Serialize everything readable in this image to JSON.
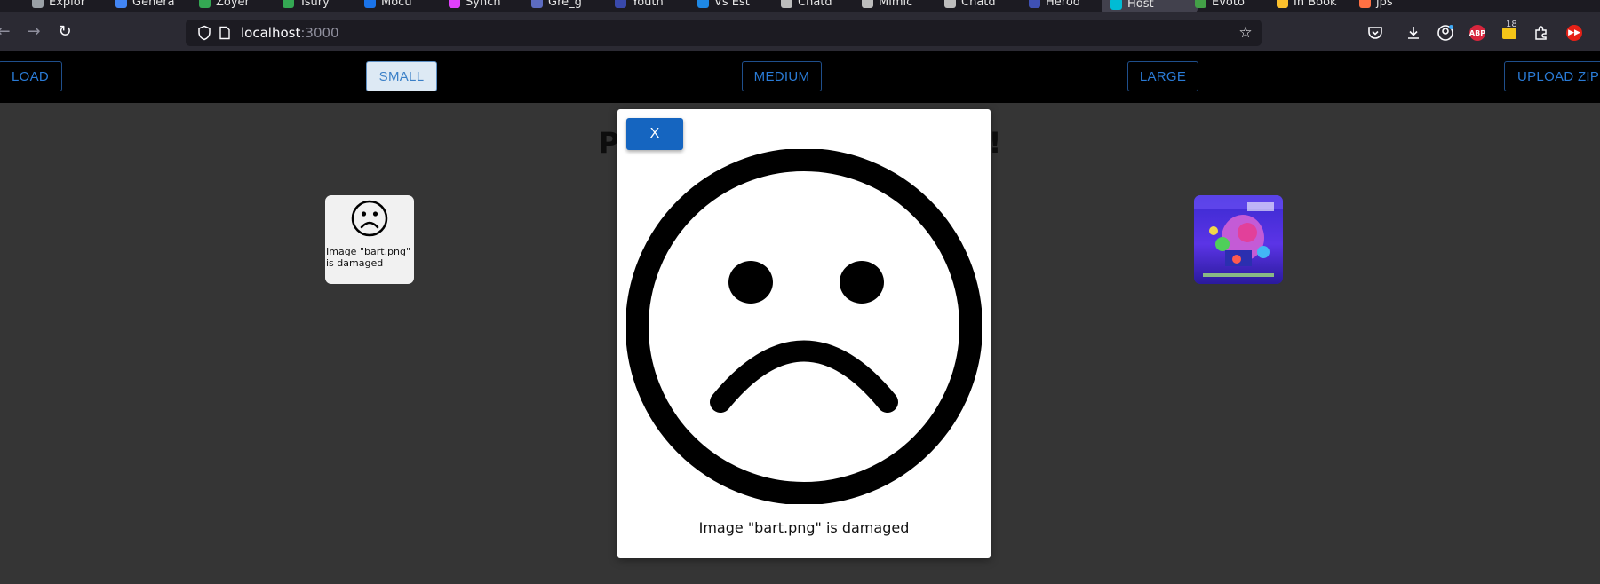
{
  "browser": {
    "tabs": [
      {
        "label": "Explor",
        "color": "#9aa0a6"
      },
      {
        "label": "Genera",
        "color": "#4285f4"
      },
      {
        "label": "Zoyer",
        "color": "#34a853"
      },
      {
        "label": "Tsury",
        "color": "#34a853"
      },
      {
        "label": "Mocu",
        "color": "#1a73e8"
      },
      {
        "label": "Synch",
        "color": "#e040fb"
      },
      {
        "label": "Gre_g",
        "color": "#5c6bc0"
      },
      {
        "label": "Youth",
        "color": "#3949ab"
      },
      {
        "label": "Vs Est",
        "color": "#1e88e5"
      },
      {
        "label": "Chatd",
        "color": "#bdbdbd"
      },
      {
        "label": "Mimic",
        "color": "#bdbdbd"
      },
      {
        "label": "Chatd",
        "color": "#bdbdbd"
      },
      {
        "label": "Herod",
        "color": "#3f51b5"
      },
      {
        "label": "Host",
        "color": "#00bcd4",
        "active": true
      },
      {
        "label": "Evoto",
        "color": "#43a047"
      },
      {
        "label": "In Book",
        "color": "#fbc02d"
      },
      {
        "label": "jps",
        "color": "#ff7043"
      }
    ],
    "url_host": "localhost",
    "url_port": ":3000",
    "extension_badge": "18",
    "abp_label": "ABP"
  },
  "toolbar": {
    "load": "LOAD",
    "small": "SMALL",
    "medium": "MEDIUM",
    "large": "LARGE",
    "upload_zip": "UPLOAD ZIP"
  },
  "page": {
    "title": "Photo Viewer Manager!!!"
  },
  "thumbnails": [
    {
      "text": "Image \"bart.png\" is damaged",
      "state": "broken"
    },
    {
      "state": "image",
      "description": "colorful animated movie poster"
    }
  ],
  "modal": {
    "close_label": "X",
    "caption": "Image \"bart.png\" is damaged"
  },
  "colors": {
    "page_bg": "#353535",
    "toolbar_bg": "#000000",
    "button_text": "#2a7bd6",
    "close_button": "#1565c0"
  }
}
